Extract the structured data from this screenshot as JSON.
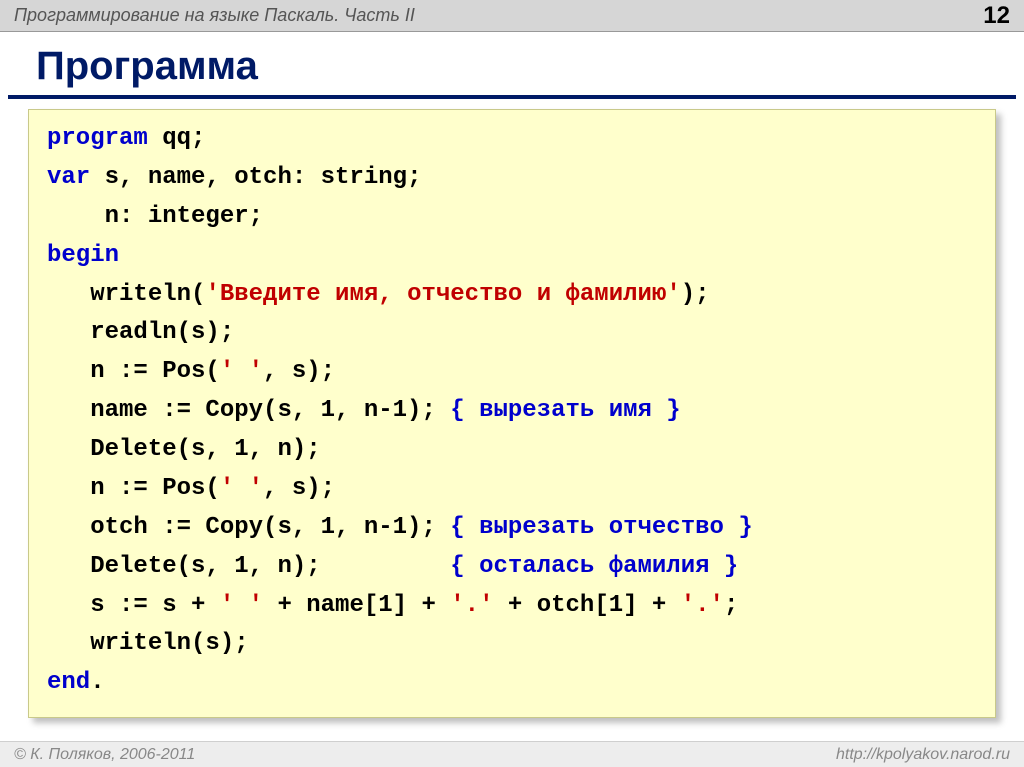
{
  "header": {
    "title": "Программирование на языке Паскаль. Часть II",
    "page_number": "12"
  },
  "slide": {
    "heading": "Программа"
  },
  "code": {
    "l1_kw": "program",
    "l1_rest": " qq;",
    "l2_kw": "var",
    "l2_rest": " s, name, otch: string;",
    "l3": "    n: integer;",
    "l4_kw": "begin",
    "l5_a": "   writeln(",
    "l5_str": "'Введите имя, отчество и фамилию'",
    "l5_b": ");",
    "l6": "   readln(s);",
    "l7_a": "   n := Pos(",
    "l7_str": "' '",
    "l7_b": ", s);",
    "l8_a": "   name := Copy(s, 1, n-1); ",
    "l8_comment": "{ вырезать имя }",
    "l9": "   Delete(s, 1, n);",
    "l10_a": "   n := Pos(",
    "l10_str": "' '",
    "l10_b": ", s);",
    "l11_a": "   otch := Copy(s, 1, n-1); ",
    "l11_comment": "{ вырезать отчество }",
    "l12_a": "   Delete(s, 1, n);         ",
    "l12_comment": "{ осталась фамилия }",
    "l13_a": "   s := s + ",
    "l13_s1": "' '",
    "l13_b": " + name[1] + ",
    "l13_s2": "'.'",
    "l13_c": " + otch[1] + ",
    "l13_s3": "'.'",
    "l13_d": ";",
    "l14": "   writeln(s);",
    "l15_kw": "end",
    "l15_rest": "."
  },
  "footer": {
    "copyright": "© К. Поляков, 2006-2011",
    "url": "http://kpolyakov.narod.ru"
  }
}
